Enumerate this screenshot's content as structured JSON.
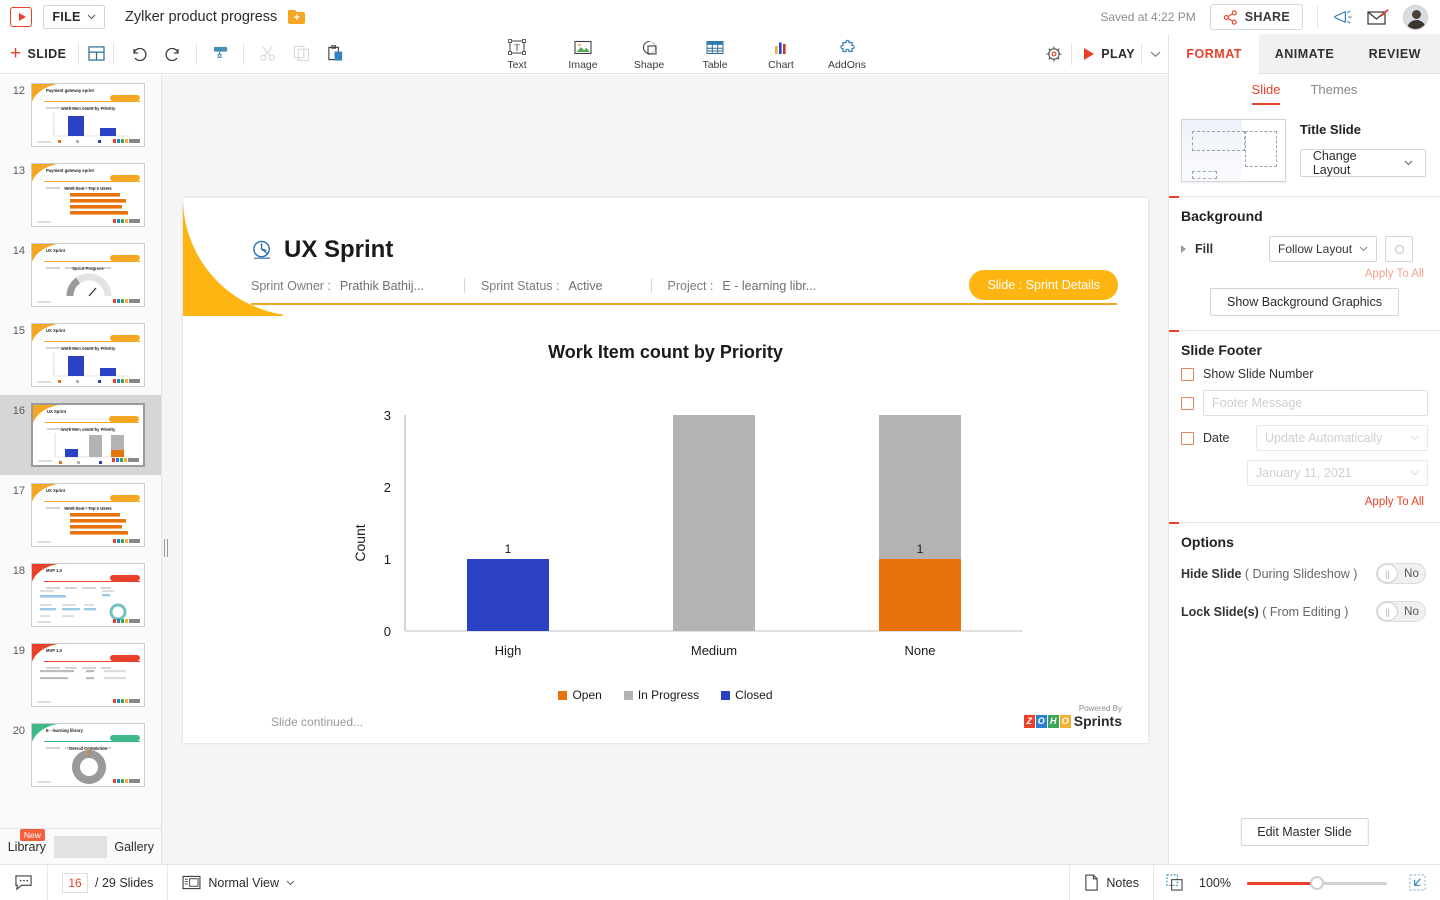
{
  "app": {
    "logo": "zoho-show-logo",
    "file_menu": "FILE",
    "doc_title": "Zylker product progress",
    "saved_status": "Saved at 4:22 PM",
    "share_label": "SHARE"
  },
  "toolbar": {
    "add_slide_label": "SLIDE",
    "add_slide_plus": "+",
    "icons": [
      "layout-icon",
      "undo-icon",
      "redo-icon",
      "format-painter-icon",
      "cut-icon",
      "copy-icon",
      "paste-icon"
    ],
    "insert_items": [
      {
        "label": "Text",
        "icon": "text-box-icon"
      },
      {
        "label": "Image",
        "icon": "image-icon"
      },
      {
        "label": "Shape",
        "icon": "shape-icon"
      },
      {
        "label": "Table",
        "icon": "table-icon"
      },
      {
        "label": "Chart",
        "icon": "chart-icon"
      },
      {
        "label": "AddOns",
        "icon": "addons-puzzle-icon"
      }
    ],
    "settings_icon": "settings-gear-icon",
    "play_label": "PLAY"
  },
  "right_panel": {
    "tabs": [
      {
        "label": "FORMAT",
        "active": true
      },
      {
        "label": "ANIMATE",
        "active": false
      },
      {
        "label": "REVIEW",
        "active": false
      }
    ],
    "subtabs": [
      {
        "label": "Slide",
        "active": true
      },
      {
        "label": "Themes",
        "active": false
      }
    ],
    "layout": {
      "title": "Title Slide",
      "change_layout_label": "Change Layout"
    },
    "background": {
      "heading": "Background",
      "fill_label": "Fill",
      "fill_value": "Follow Layout",
      "apply_to_all": "Apply To All",
      "show_bg_graphics": "Show Background Graphics"
    },
    "slide_footer": {
      "heading": "Slide Footer",
      "show_slide_number": "Show Slide Number",
      "footer_message_placeholder": "Footer Message",
      "footer_message_value": "",
      "date_label": "Date",
      "date_mode": "Update Automatically",
      "date_value": "January 11, 2021",
      "apply_to_all": "Apply To All"
    },
    "options": {
      "heading": "Options",
      "hide_slide_label": "Hide Slide",
      "hide_slide_sub": "( During Slideshow )",
      "hide_slide_value": "No",
      "lock_slide_label": "Lock Slide(s)",
      "lock_slide_sub": "( From Editing )",
      "lock_slide_value": "No"
    },
    "edit_master_slide": "Edit Master Slide"
  },
  "slide_panel": {
    "thumbnails": [
      {
        "num": "12",
        "kind": "bar-vertical",
        "accent": "#f5a623",
        "title": "Payment gateway sprint",
        "selected": false
      },
      {
        "num": "13",
        "kind": "bar-horizontal",
        "accent": "#f5a623",
        "title": "Payment gateway sprint",
        "selected": false
      },
      {
        "num": "14",
        "kind": "gauge",
        "accent": "#f5a623",
        "title": "UX Sprint",
        "selected": false
      },
      {
        "num": "15",
        "kind": "bar-vertical",
        "accent": "#f5a623",
        "title": "UX Sprint",
        "selected": false
      },
      {
        "num": "16",
        "kind": "stacked-bar",
        "accent": "#f5a623",
        "title": "UX Sprint",
        "selected": true
      },
      {
        "num": "17",
        "kind": "bar-horizontal",
        "accent": "#f5a623",
        "title": "UX Sprint",
        "selected": false
      },
      {
        "num": "18",
        "kind": "detail",
        "accent": "#e8402a",
        "title": "MVP 1.0",
        "selected": false
      },
      {
        "num": "19",
        "kind": "list",
        "accent": "#e8402a",
        "title": "MVP 1.0",
        "selected": false
      },
      {
        "num": "20",
        "kind": "donut",
        "accent": "#3fb98a",
        "title": "E - learning library",
        "selected": false
      }
    ],
    "library_label": "Library",
    "library_badge": "New",
    "gallery_label": "Gallery"
  },
  "slide": {
    "title": "UX Sprint",
    "title_icon": "sprint-clock-icon",
    "meta": [
      {
        "label": "Sprint Owner :",
        "value": "Prathik Bathij..."
      },
      {
        "label": "Sprint Status :",
        "value": "Active"
      },
      {
        "label": "Project :",
        "value": "E - learning libr..."
      }
    ],
    "tag": "Slide : Sprint Details",
    "continued": "Slide continued...",
    "powered_by_label": "Powered By",
    "powered_by_brand": "Sprints",
    "powered_by_logo": "zoho-logo",
    "accent_color": "#ffb511"
  },
  "chart_data": {
    "type": "bar",
    "stacked": true,
    "title": "Work Item count by Priority",
    "xlabel": "",
    "ylabel": "Count",
    "categories": [
      "High",
      "Medium",
      "None"
    ],
    "ylim": [
      0,
      3
    ],
    "yticks": [
      0,
      1,
      2,
      3
    ],
    "grid": false,
    "legend_position": "bottom",
    "series": [
      {
        "name": "Open",
        "color": "#e8730c",
        "values": [
          0,
          0,
          1
        ]
      },
      {
        "name": "In Progress",
        "color": "#b3b3b3",
        "values": [
          0,
          3,
          2
        ]
      },
      {
        "name": "Closed",
        "color": "#2a41c4",
        "values": [
          1,
          0,
          0
        ]
      }
    ],
    "data_labels": [
      {
        "category": "High",
        "text": "1",
        "above_bar": true
      },
      {
        "category": "None",
        "text": "1",
        "above_bar": false
      }
    ]
  },
  "status_bar": {
    "comment_icon": "comment-icon",
    "current_slide": "16",
    "total_slides": "/ 29 Slides",
    "view_mode": "Normal View",
    "view_icon": "normal-view-icon",
    "notes_label": "Notes",
    "notes_icon": "notes-page-icon",
    "grid_icon": "guides-icon",
    "zoom_level": "100%",
    "fit_icon": "fit-to-screen-icon"
  }
}
